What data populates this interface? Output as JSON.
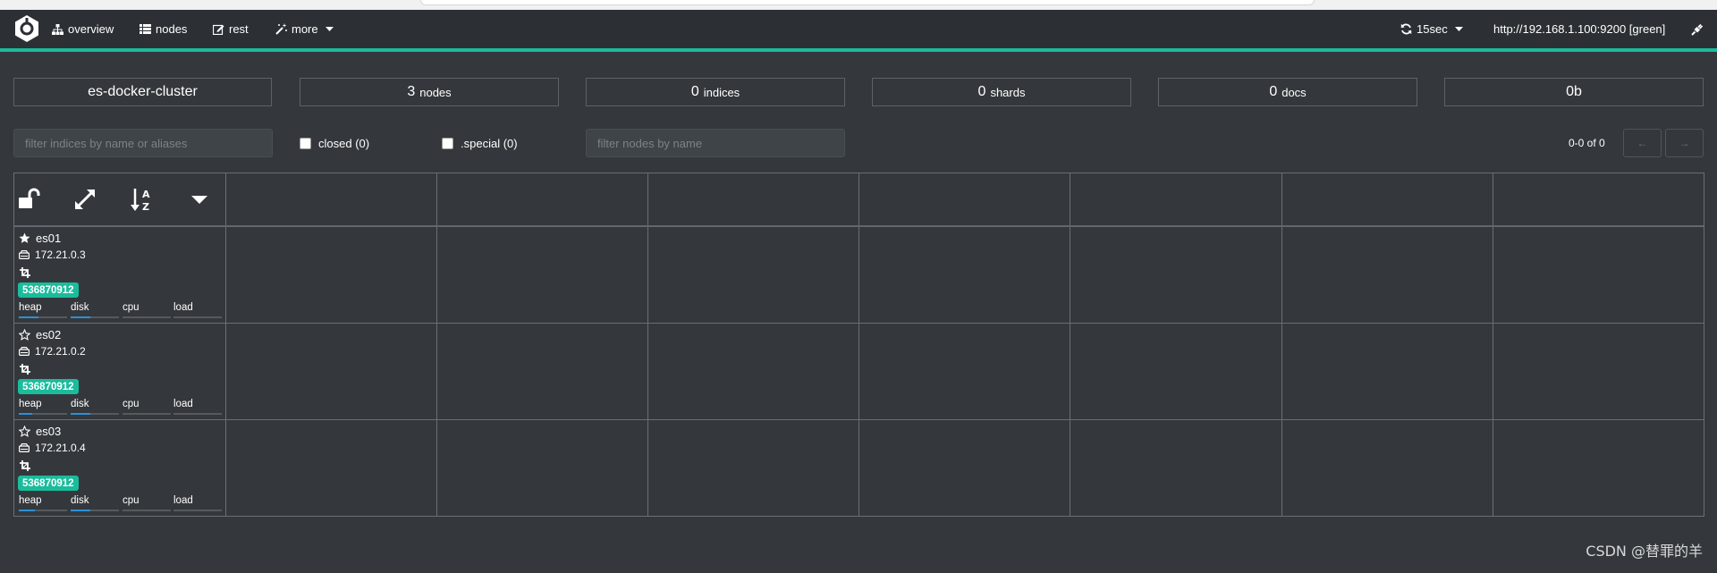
{
  "navbar": {
    "items": [
      {
        "label": "overview",
        "icon": "sitemap-icon"
      },
      {
        "label": "nodes",
        "icon": "list-icon"
      },
      {
        "label": "rest",
        "icon": "edit-icon"
      },
      {
        "label": "more",
        "icon": "wand-icon"
      }
    ],
    "refresh": "15sec",
    "connection": "http://192.168.1.100:9200 [green]"
  },
  "stats": {
    "cluster_name": "es-docker-cluster",
    "nodes_value": "3",
    "nodes_label": "nodes",
    "indices_value": "0",
    "indices_label": "indices",
    "shards_value": "0",
    "shards_label": "shards",
    "docs_value": "0",
    "docs_label": "docs",
    "size": "0b"
  },
  "filters": {
    "indices_placeholder": "filter indices by name or aliases",
    "closed_label": "closed (0)",
    "special_label": ".special (0)",
    "nodes_placeholder": "filter nodes by name"
  },
  "pager": {
    "text": "0-0 of 0",
    "prev": "←",
    "next": "→"
  },
  "nodes": [
    {
      "name": "es01",
      "master": true,
      "ip": "172.21.0.3",
      "badge": "536870912",
      "metrics": [
        {
          "label": "heap",
          "fill": 0.4
        },
        {
          "label": "disk",
          "fill": 0.4
        },
        {
          "label": "cpu",
          "fill": 0
        },
        {
          "label": "load",
          "fill": 0
        }
      ]
    },
    {
      "name": "es02",
      "master": false,
      "ip": "172.21.0.2",
      "badge": "536870912",
      "metrics": [
        {
          "label": "heap",
          "fill": 0.28
        },
        {
          "label": "disk",
          "fill": 0.4
        },
        {
          "label": "cpu",
          "fill": 0
        },
        {
          "label": "load",
          "fill": 0
        }
      ]
    },
    {
      "name": "es03",
      "master": false,
      "ip": "172.21.0.4",
      "badge": "536870912",
      "metrics": [
        {
          "label": "heap",
          "fill": 0.34
        },
        {
          "label": "disk",
          "fill": 0.4
        },
        {
          "label": "cpu",
          "fill": 0
        },
        {
          "label": "load",
          "fill": 0
        }
      ]
    }
  ],
  "watermark": "CSDN @替罪的羊",
  "colors": {
    "accent": "#1abc9c",
    "background": "#34383c",
    "navbar": "#2c3034",
    "metric_fill": "#2f8fd8"
  }
}
